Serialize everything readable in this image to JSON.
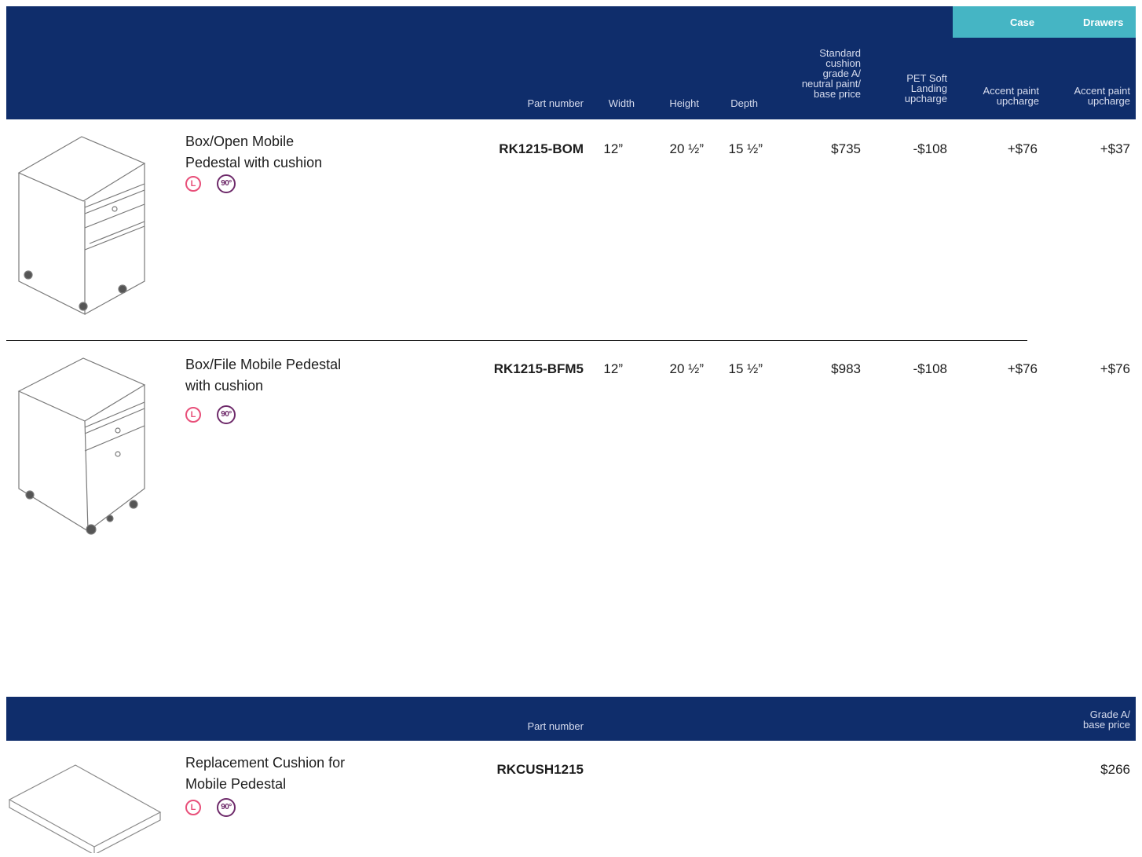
{
  "table1": {
    "accent_headers": {
      "case": "Case",
      "drawers": "Drawers"
    },
    "columns": {
      "part_number": "Part number",
      "width": "Width",
      "height": "Height",
      "depth": "Depth",
      "standard_price": "Standard\ncushion\ngrade A/\nneutral paint/\nbase price",
      "pet_soft": "PET Soft\nLanding\nupcharge",
      "accent_case": "Accent paint\nupcharge",
      "accent_drawers": "Accent paint\nupcharge"
    },
    "rows": [
      {
        "title": "Box/Open Mobile\nPedestal with cushion",
        "badge_l": "L",
        "badge_90": "90°",
        "part_number": "RK1215-BOM",
        "width": "12”",
        "height": "20 ½”",
        "depth": "15 ½”",
        "price": "$735",
        "pet": "-$108",
        "accent_case": "+$76",
        "accent_drawers": "+$37"
      },
      {
        "title": "Box/File Mobile Pedestal\nwith cushion",
        "badge_l": "L",
        "badge_90": "90°",
        "part_number": "RK1215-BFM5",
        "width": "12”",
        "height": "20 ½”",
        "depth": "15 ½”",
        "price": "$983",
        "pet": "-$108",
        "accent_case": "+$76",
        "accent_drawers": "+$76"
      }
    ]
  },
  "table2": {
    "columns": {
      "part_number": "Part number",
      "price": "Grade A/\nbase price"
    },
    "rows": [
      {
        "title": "Replacement Cushion for\nMobile Pedestal",
        "badge_l": "L",
        "badge_90": "90°",
        "part_number": "RKCUSH1215",
        "price": "$266"
      }
    ]
  }
}
